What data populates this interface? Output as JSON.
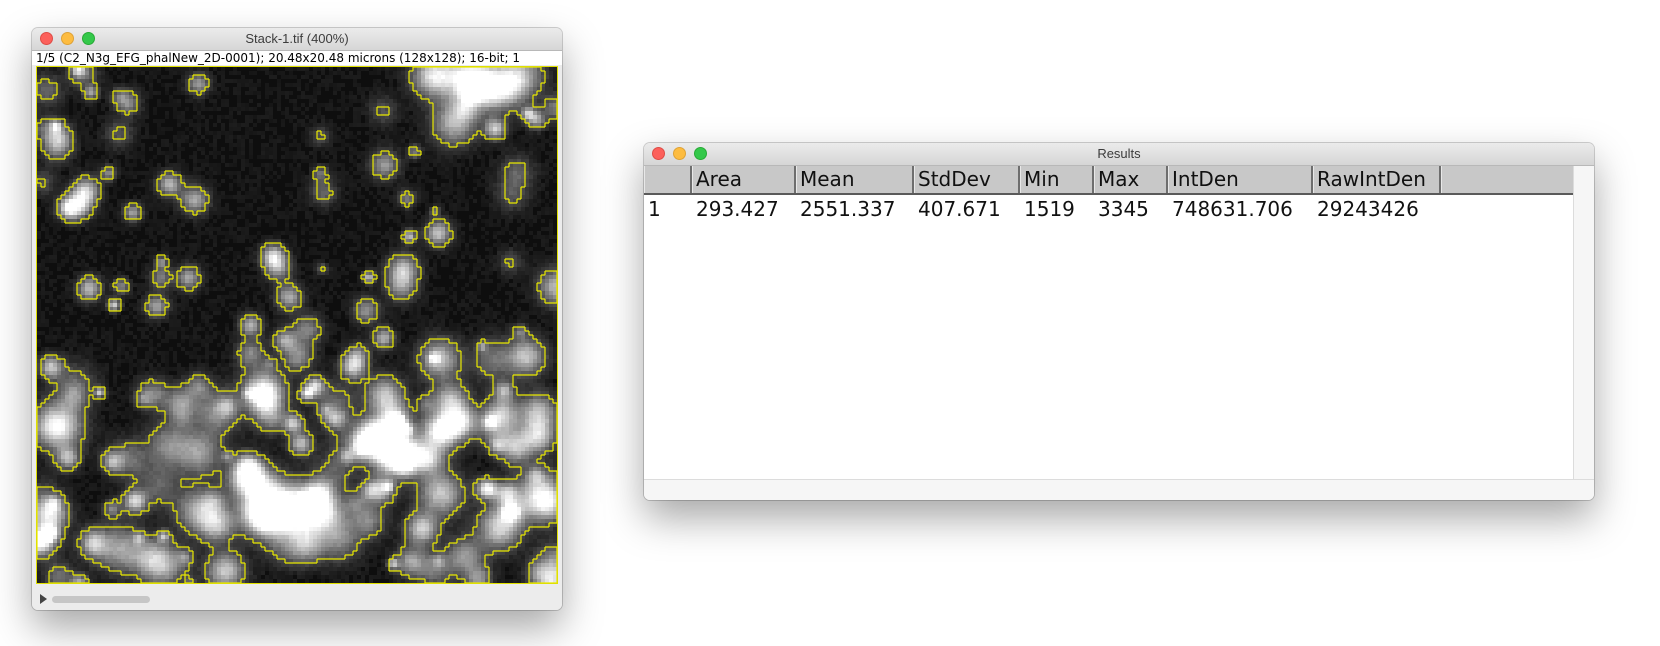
{
  "image_window": {
    "title": "Stack-1.tif (400%)",
    "info": "1/5 (C2_N3g_EFG_phalNew_2D-0001); 20.48x20.48 microns (128x128); 16-bit; 1"
  },
  "results_window": {
    "title": "Results",
    "columns": [
      "",
      "Area",
      "Mean",
      "StdDev",
      "Min",
      "Max",
      "IntDen",
      "RawIntDen"
    ],
    "rows": [
      [
        "1",
        "293.427",
        "2551.337",
        "407.671",
        "1519",
        "3345",
        "748631.706",
        "29243426"
      ]
    ]
  },
  "colors": {
    "roi_outline": "#e8e800",
    "close": "#fc605b",
    "minimize": "#fdbc40",
    "maximize": "#34c84a"
  }
}
